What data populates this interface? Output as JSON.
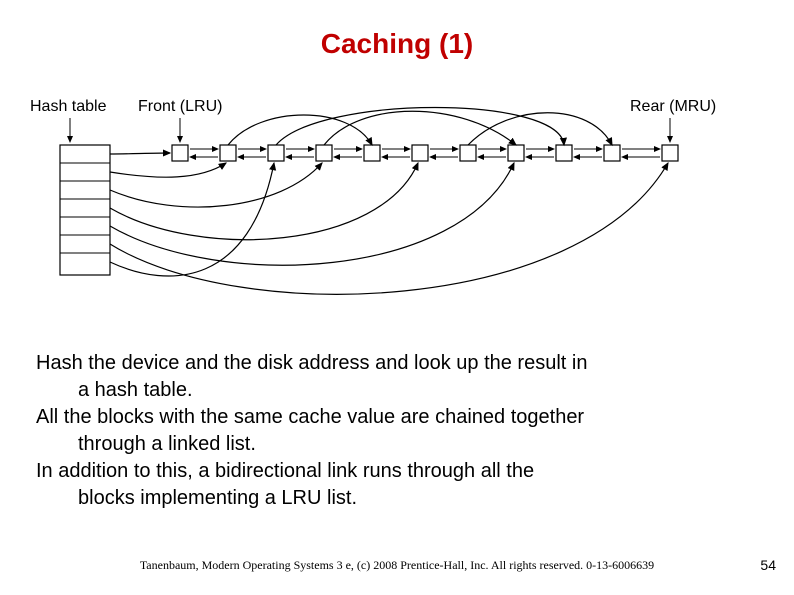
{
  "title": "Caching (1)",
  "labels": {
    "hash_table": "Hash table",
    "front": "Front (LRU)",
    "rear": "Rear (MRU)"
  },
  "body": {
    "p1a": "Hash the device and the disk address and look up the result in",
    "p1b": "a hash table.",
    "p2a": "All the blocks with the same cache value are chained together",
    "p2b": "through a linked list.",
    "p3a": "In addition to this, a bidirectional link runs through all the",
    "p3b": "blocks implementing a LRU list."
  },
  "citation": "Tanenbaum, Modern Operating Systems 3 e, (c) 2008 Prentice-Hall, Inc. All rights reserved. 0-13-6006639",
  "page_number": "54"
}
